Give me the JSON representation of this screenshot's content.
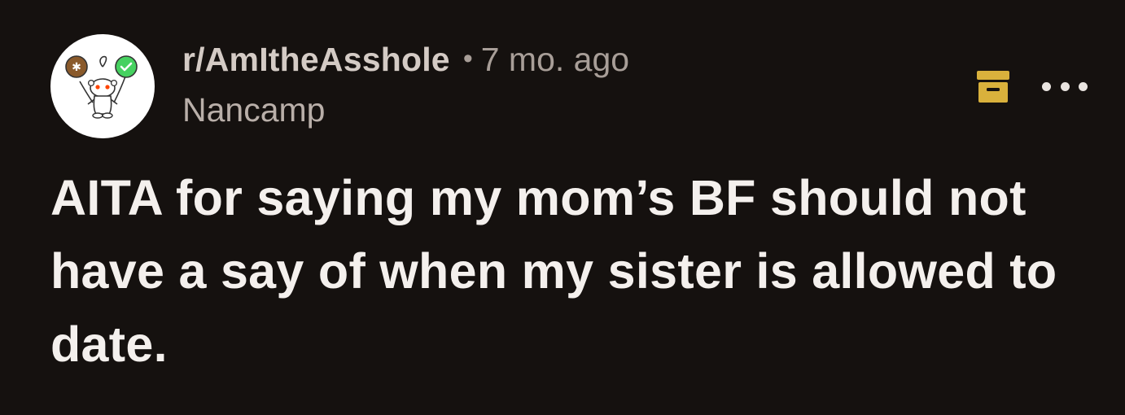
{
  "post": {
    "subreddit": "r/AmItheAsshole",
    "separator": "•",
    "time_ago": "7 mo. ago",
    "author": "Nancamp",
    "title": "AITA for saying my mom’s BF should not have a say of when my sister is allowed to date."
  },
  "icons": {
    "avatar": "snoo-avatar-icon",
    "archive": "archive-icon",
    "more": "more-options-icon"
  },
  "colors": {
    "background": "#15110f",
    "title_text": "#f4f0ed",
    "meta_text": "#a89e98",
    "archive_accent": "#d9b13c"
  }
}
